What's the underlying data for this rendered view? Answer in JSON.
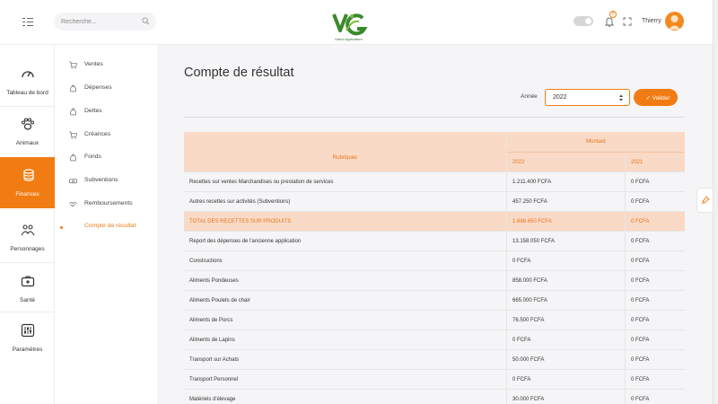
{
  "header": {
    "search_placeholder": "Recherche...",
    "logo_tagline": "Vision Agriculture",
    "notification_count": "0",
    "user_name": "Thierry",
    "accent_color": "#f07c13"
  },
  "sidebar": {
    "items": [
      {
        "label": "Tableau de bord",
        "icon": "gauge-icon"
      },
      {
        "label": "Animaux",
        "icon": "paw-icon"
      },
      {
        "label": "Finances",
        "icon": "coins-icon",
        "active": true
      },
      {
        "label": "Personnages",
        "icon": "people-icon"
      },
      {
        "label": "Santé",
        "icon": "medical-kit-icon"
      },
      {
        "label": "Paramètres",
        "icon": "sliders-icon"
      }
    ]
  },
  "submenu": {
    "items": [
      {
        "label": "Ventes",
        "icon": "cart-icon"
      },
      {
        "label": "Dépenses",
        "icon": "money-bag-icon"
      },
      {
        "label": "Dettes",
        "icon": "money-bag-icon"
      },
      {
        "label": "Créances",
        "icon": "cart-icon"
      },
      {
        "label": "Fonds",
        "icon": "money-bag-icon"
      },
      {
        "label": "Subventions",
        "icon": "banknote-icon"
      },
      {
        "label": "Remboursements",
        "icon": "handshake-icon"
      },
      {
        "label": "Compte de résultat",
        "icon": "dot-icon",
        "active": true
      }
    ]
  },
  "main": {
    "title": "Compte de résultat",
    "year_label": "Année",
    "year_value": "2022",
    "validate_label": "Valider",
    "table": {
      "header_montant": "Montant",
      "header_rubriques": "Rubriques",
      "years": [
        "2022",
        "2021"
      ],
      "rows": [
        {
          "label": "Recettes sur ventes Marchandises ou prestation de services",
          "y2022": "1.211.400 FCFA",
          "y2021": "0 FCFA"
        },
        {
          "label": "Autres recettes sur activités (Subventions)",
          "y2022": "457.250 FCFA",
          "y2021": "0 FCFA"
        },
        {
          "label": "TOTAL DES RECETTES SUR PRODUITS",
          "y2022": "1.668.650 FCFA",
          "y2021": "0 FCFA",
          "total": true
        },
        {
          "label": "Report des dépenses de l'ancienne application",
          "y2022": "13.158.050 FCFA",
          "y2021": "0 FCFA"
        },
        {
          "label": "Constructions",
          "y2022": "0 FCFA",
          "y2021": "0 FCFA"
        },
        {
          "label": "Aliments Pondeuses",
          "y2022": "858.000 FCFA",
          "y2021": "0 FCFA"
        },
        {
          "label": "Aliments Poulets de chair",
          "y2022": "665.000 FCFA",
          "y2021": "0 FCFA"
        },
        {
          "label": "Aliments de Porcs",
          "y2022": "76.500 FCFA",
          "y2021": "0 FCFA"
        },
        {
          "label": "Aliments de Lapins",
          "y2022": "0 FCFA",
          "y2021": "0 FCFA"
        },
        {
          "label": "Transport sur Achats",
          "y2022": "50.000 FCFA",
          "y2021": "0 FCFA"
        },
        {
          "label": "Transport Personnel",
          "y2022": "0 FCFA",
          "y2021": "0 FCFA"
        },
        {
          "label": "Matériels d'élevage",
          "y2022": "30.000 FCFA",
          "y2021": "0 FCFA"
        }
      ]
    }
  }
}
